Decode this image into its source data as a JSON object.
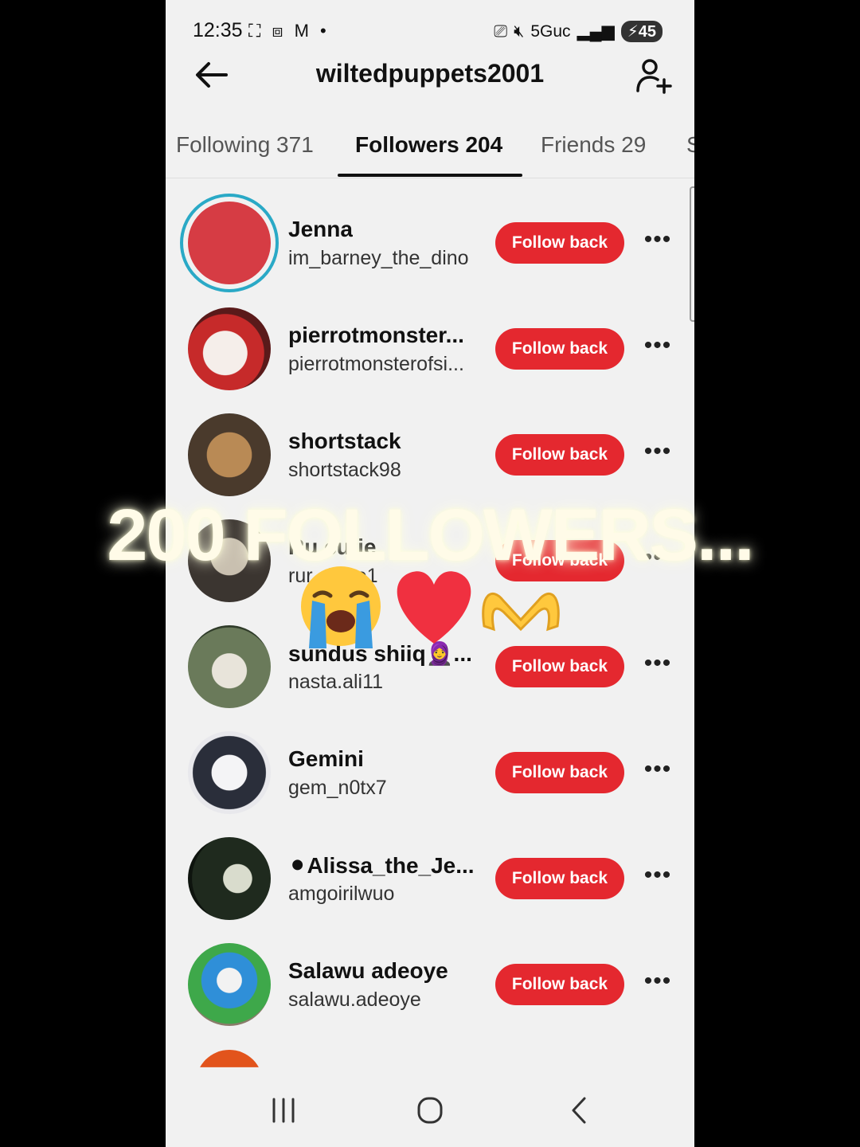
{
  "status": {
    "time": "12:35",
    "network": "5Guc",
    "battery": "45"
  },
  "header": {
    "title": "wiltedpuppets2001"
  },
  "tabs": [
    {
      "label": "Following 371"
    },
    {
      "label": "Followers 204"
    },
    {
      "label": "Friends 29"
    },
    {
      "label": "S"
    }
  ],
  "rows": [
    {
      "name": "Jenna",
      "handle": "im_barney_the_dino",
      "button": "Follow back"
    },
    {
      "name": "pierrotmonster...",
      "handle": "pierrotmonsterofsi...",
      "button": "Follow back"
    },
    {
      "name": "shortstack",
      "handle": "shortstack98",
      "button": "Follow back"
    },
    {
      "name": "Ru cutie",
      "handle": "rur she e1",
      "button": "Follow back"
    },
    {
      "name": "sundus shiiq🧕...",
      "handle": "nasta.ali11",
      "button": "Follow back"
    },
    {
      "name": "Gemini",
      "handle": "gem_n0tx7",
      "button": "Follow back"
    },
    {
      "name": "⚫Alissa_the_Je...",
      "handle": "amgoirilwuo",
      "button": "Follow back"
    },
    {
      "name": "Salawu adeoye",
      "handle": "salawu.adeoye",
      "button": "Follow back"
    }
  ],
  "more_glyph": "•••",
  "overlay": {
    "text": "200 FOLLOWERS...",
    "emojis": [
      "😭",
      "❤️",
      "🫶"
    ]
  },
  "colors": {
    "follow_button": "#e4282f",
    "story_ring": "#2aa9c6",
    "background": "#f1f1f1"
  }
}
